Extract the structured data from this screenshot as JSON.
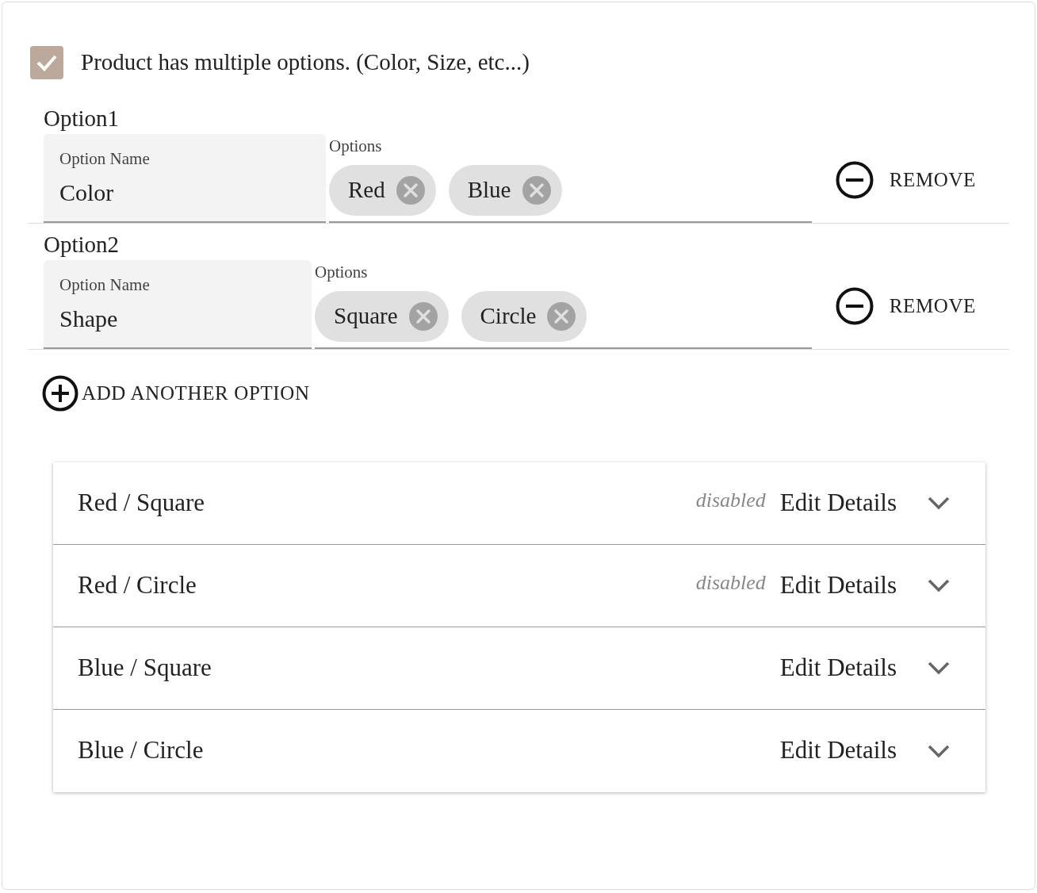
{
  "enable": {
    "checked": true,
    "label": "Product has multiple options. (Color, Size, etc...)"
  },
  "options": [
    {
      "title": "Option1",
      "name_label": "Option Name",
      "name_value": "Color",
      "values_label": "Options",
      "values": [
        "Red",
        "Blue"
      ],
      "remove": "REMOVE"
    },
    {
      "title": "Option2",
      "name_label": "Option Name",
      "name_value": "Shape",
      "values_label": "Options",
      "values": [
        "Square",
        "Circle"
      ],
      "remove": "REMOVE"
    }
  ],
  "add_button": "ADD ANOTHER OPTION",
  "variants": [
    {
      "name": "Red / Square",
      "status": "disabled",
      "action": "Edit Details"
    },
    {
      "name": "Red / Circle",
      "status": "disabled",
      "action": "Edit Details"
    },
    {
      "name": "Blue / Square",
      "action": "Edit Details"
    },
    {
      "name": "Blue / Circle",
      "action": "Edit Details"
    }
  ]
}
